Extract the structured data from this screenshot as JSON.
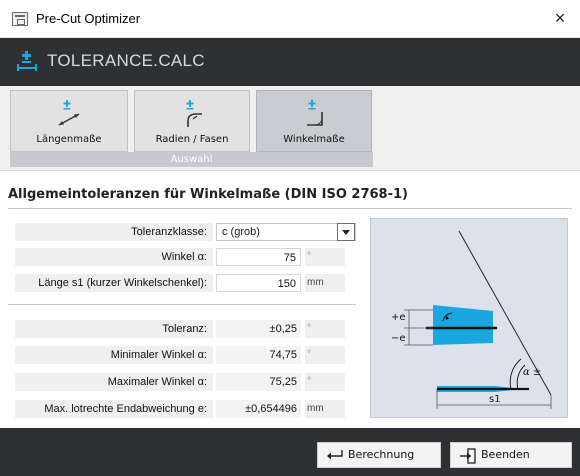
{
  "window": {
    "title": "Pre-Cut Optimizer",
    "close_glyph": "×"
  },
  "brand": {
    "name": "TOLERANCE.CALC",
    "icon": "plus-minus-tolerance-icon"
  },
  "ribbon": {
    "group_label": "Auswahl",
    "tools": [
      {
        "label": "Längenmaße",
        "icon": "length-dimension-icon",
        "active": false
      },
      {
        "label": "Radien / Fasen",
        "icon": "radius-chamfer-icon",
        "active": false
      },
      {
        "label": "Winkelmaße",
        "icon": "angle-dimension-icon",
        "active": true
      }
    ]
  },
  "form": {
    "heading": "Allgemeintoleranzen für Winkelmaße (DIN ISO 2768-1)",
    "tolerance_class": {
      "label": "Toleranzklasse:",
      "value": "c (grob)"
    },
    "angle": {
      "label": "Winkel α:",
      "value": "75",
      "unit": "°"
    },
    "length": {
      "label": "Länge s1 (kurzer Winkelschenkel):",
      "value": "150",
      "unit": "mm"
    }
  },
  "results": {
    "tolerance": {
      "label": "Toleranz:",
      "value": "±0,25",
      "unit": "°"
    },
    "min_angle": {
      "label": "Minimaler Winkel α:",
      "value": "74,75",
      "unit": "°"
    },
    "max_angle": {
      "label": "Maximaler Winkel α:",
      "value": "75,25",
      "unit": "°"
    },
    "deviation": {
      "label": "Max. lotrechte Endabweichung e:",
      "value": "±0,654496",
      "unit": "mm"
    }
  },
  "diagram": {
    "plus_e": "+e",
    "minus_e": "−e",
    "alpha_label": "α ±",
    "s1_label": "s1"
  },
  "footer": {
    "calculate_label": "Berechnung",
    "exit_label": "Beenden"
  },
  "colors": {
    "accent_blue": "#1aa7e0",
    "dark_bar": "#2e3034",
    "brand_text": "#d4dae2",
    "diagram_bg": "#dbe2ec"
  }
}
